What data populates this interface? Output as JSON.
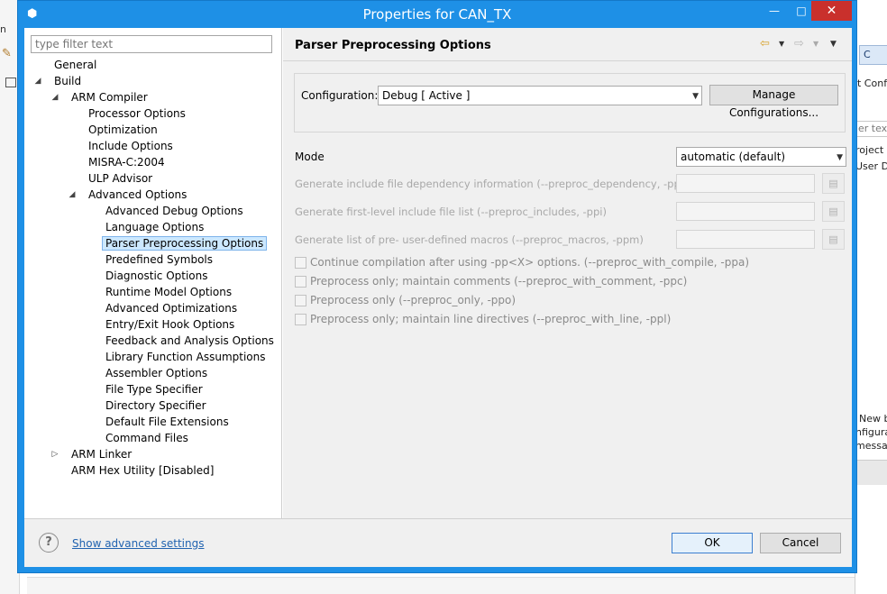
{
  "background": {
    "left_text": "n",
    "right_tab": "C",
    "right_texts": [
      "t Conf",
      "er text",
      "roject",
      "User De",
      "New b",
      "nfigura",
      "messa"
    ]
  },
  "dialog": {
    "title": "Properties for CAN_TX",
    "window_buttons": {
      "minimize": "—",
      "maximize": "□",
      "close": "✕"
    }
  },
  "tree": {
    "filter_placeholder": "type filter text",
    "nodes": [
      {
        "label": "General",
        "expanded": null
      },
      {
        "label": "Build",
        "expanded": true
      },
      {
        "label": "ARM Compiler",
        "expanded": true
      },
      {
        "label": "Processor Options",
        "expanded": null
      },
      {
        "label": "Optimization",
        "expanded": null
      },
      {
        "label": "Include Options",
        "expanded": null
      },
      {
        "label": "MISRA-C:2004",
        "expanded": null
      },
      {
        "label": "ULP Advisor",
        "expanded": null
      },
      {
        "label": "Advanced Options",
        "expanded": true
      },
      {
        "label": "Advanced Debug Options",
        "expanded": null
      },
      {
        "label": "Language Options",
        "expanded": null
      },
      {
        "label": "Parser Preprocessing Options",
        "expanded": null,
        "selected": true
      },
      {
        "label": "Predefined Symbols",
        "expanded": null
      },
      {
        "label": "Diagnostic Options",
        "expanded": null
      },
      {
        "label": "Runtime Model Options",
        "expanded": null
      },
      {
        "label": "Advanced Optimizations",
        "expanded": null
      },
      {
        "label": "Entry/Exit Hook Options",
        "expanded": null
      },
      {
        "label": "Feedback and Analysis Options",
        "expanded": null
      },
      {
        "label": "Library Function Assumptions",
        "expanded": null
      },
      {
        "label": "Assembler Options",
        "expanded": null
      },
      {
        "label": "File Type Specifier",
        "expanded": null
      },
      {
        "label": "Directory Specifier",
        "expanded": null
      },
      {
        "label": "Default File Extensions",
        "expanded": null
      },
      {
        "label": "Command Files",
        "expanded": null
      },
      {
        "label": "ARM Linker",
        "expanded": false
      },
      {
        "label": "ARM Hex Utility  [Disabled]",
        "expanded": null
      }
    ]
  },
  "page": {
    "title": "Parser Preprocessing Options",
    "configuration": {
      "label": "Configuration:",
      "value": "Debug  [ Active ]",
      "manage_button": "Manage Configurations..."
    },
    "mode": {
      "label": "Mode",
      "value": "automatic (default)"
    },
    "text_options": [
      "Generate include file dependency information (--preproc_dependency, -ppd)",
      "Generate first-level include file list (--preproc_includes, -ppi)",
      "Generate list of pre-  user-defined macros (--preproc_macros, -ppm)"
    ],
    "checkboxes": [
      {
        "label": "Continue compilation after using -pp<X> options. (--preproc_with_compile, -ppa)",
        "checked": false
      },
      {
        "label": "Preprocess only; maintain comments (--preproc_with_comment, -ppc)",
        "checked": false
      },
      {
        "label": "Preprocess only (--preproc_only, -ppo)",
        "checked": false
      },
      {
        "label": "Preprocess only; maintain line directives (--preproc_with_line, -ppl)",
        "checked": false
      }
    ]
  },
  "footer": {
    "help_icon": "?",
    "advanced_link": "Show advanced settings",
    "ok": "OK",
    "cancel": "Cancel"
  }
}
